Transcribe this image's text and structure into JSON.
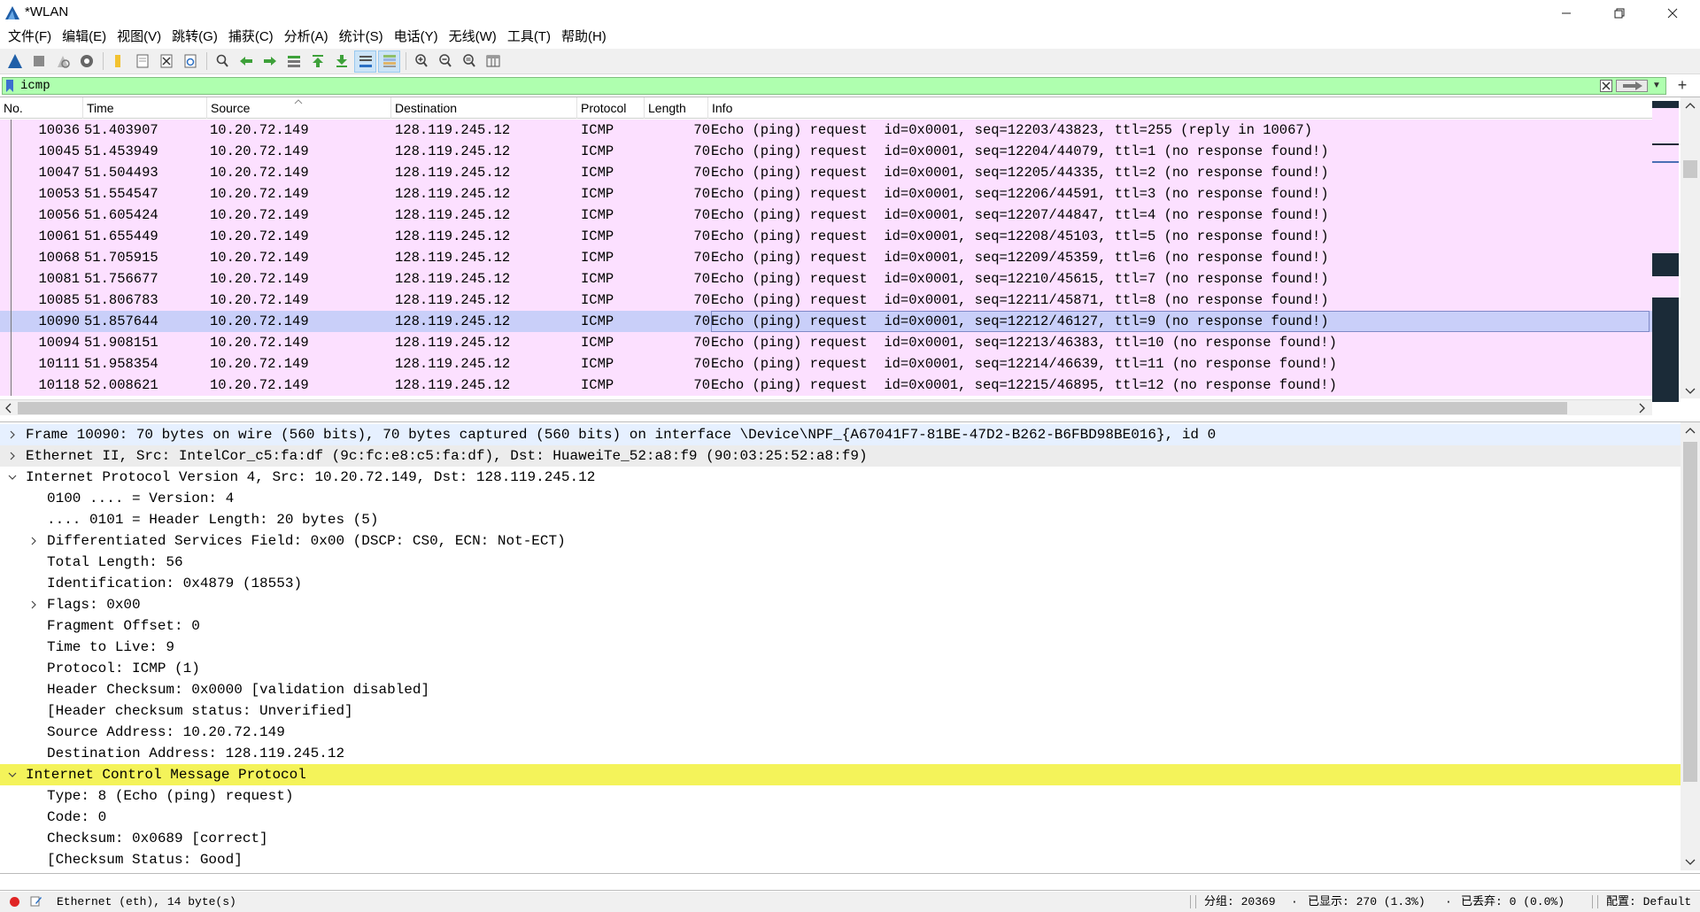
{
  "window": {
    "title": "*WLAN",
    "minimize_icon": "minimize-icon",
    "restore_icon": "restore-icon",
    "close_icon": "close-icon"
  },
  "menu": [
    {
      "label": "文件(F)"
    },
    {
      "label": "编辑(E)"
    },
    {
      "label": "视图(V)"
    },
    {
      "label": "跳转(G)"
    },
    {
      "label": "捕获(C)"
    },
    {
      "label": "分析(A)"
    },
    {
      "label": "统计(S)"
    },
    {
      "label": "电话(Y)"
    },
    {
      "label": "无线(W)"
    },
    {
      "label": "工具(T)"
    },
    {
      "label": "帮助(H)"
    }
  ],
  "toolbar": {
    "icons": [
      "shark-fin-start-icon",
      "stop-icon",
      "restart-icon",
      "capture-options-icon",
      "open-folder-icon",
      "save-file-icon",
      "close-file-icon",
      "reload-icon",
      "find-icon",
      "go-back-icon",
      "go-forward-icon",
      "go-to-packet-icon",
      "first-packet-icon",
      "last-packet-icon",
      "autoscroll-icon",
      "colorize-icon",
      "zoom-in-icon",
      "zoom-out-icon",
      "normal-size-icon",
      "resize-columns-icon"
    ]
  },
  "filter": {
    "value": "icmp",
    "bookmark_icon": "bookmark-icon",
    "clear_icon": "clear-filter-icon",
    "apply_icon": "apply-filter-arrow-icon",
    "dropdown_icon": "chevron-down-icon",
    "add_label": "+"
  },
  "packet_list": {
    "columns": {
      "no": "No.",
      "time": "Time",
      "source": "Source",
      "destination": "Destination",
      "protocol": "Protocol",
      "length": "Length",
      "info": "Info"
    },
    "rows": [
      {
        "no": "10036",
        "time": "51.403907",
        "src": "10.20.72.149",
        "dst": "128.119.245.12",
        "proto": "ICMP",
        "len": "70",
        "info": "Echo (ping) request  id=0x0001, seq=12203/43823, ttl=255 (reply in 10067)"
      },
      {
        "no": "10045",
        "time": "51.453949",
        "src": "10.20.72.149",
        "dst": "128.119.245.12",
        "proto": "ICMP",
        "len": "70",
        "info": "Echo (ping) request  id=0x0001, seq=12204/44079, ttl=1 (no response found!)"
      },
      {
        "no": "10047",
        "time": "51.504493",
        "src": "10.20.72.149",
        "dst": "128.119.245.12",
        "proto": "ICMP",
        "len": "70",
        "info": "Echo (ping) request  id=0x0001, seq=12205/44335, ttl=2 (no response found!)"
      },
      {
        "no": "10053",
        "time": "51.554547",
        "src": "10.20.72.149",
        "dst": "128.119.245.12",
        "proto": "ICMP",
        "len": "70",
        "info": "Echo (ping) request  id=0x0001, seq=12206/44591, ttl=3 (no response found!)"
      },
      {
        "no": "10056",
        "time": "51.605424",
        "src": "10.20.72.149",
        "dst": "128.119.245.12",
        "proto": "ICMP",
        "len": "70",
        "info": "Echo (ping) request  id=0x0001, seq=12207/44847, ttl=4 (no response found!)"
      },
      {
        "no": "10061",
        "time": "51.655449",
        "src": "10.20.72.149",
        "dst": "128.119.245.12",
        "proto": "ICMP",
        "len": "70",
        "info": "Echo (ping) request  id=0x0001, seq=12208/45103, ttl=5 (no response found!)"
      },
      {
        "no": "10068",
        "time": "51.705915",
        "src": "10.20.72.149",
        "dst": "128.119.245.12",
        "proto": "ICMP",
        "len": "70",
        "info": "Echo (ping) request  id=0x0001, seq=12209/45359, ttl=6 (no response found!)"
      },
      {
        "no": "10081",
        "time": "51.756677",
        "src": "10.20.72.149",
        "dst": "128.119.245.12",
        "proto": "ICMP",
        "len": "70",
        "info": "Echo (ping) request  id=0x0001, seq=12210/45615, ttl=7 (no response found!)"
      },
      {
        "no": "10085",
        "time": "51.806783",
        "src": "10.20.72.149",
        "dst": "128.119.245.12",
        "proto": "ICMP",
        "len": "70",
        "info": "Echo (ping) request  id=0x0001, seq=12211/45871, ttl=8 (no response found!)"
      },
      {
        "no": "10090",
        "time": "51.857644",
        "src": "10.20.72.149",
        "dst": "128.119.245.12",
        "proto": "ICMP",
        "len": "70",
        "info": "Echo (ping) request  id=0x0001, seq=12212/46127, ttl=9 (no response found!)",
        "selected": true
      },
      {
        "no": "10094",
        "time": "51.908151",
        "src": "10.20.72.149",
        "dst": "128.119.245.12",
        "proto": "ICMP",
        "len": "70",
        "info": "Echo (ping) request  id=0x0001, seq=12213/46383, ttl=10 (no response found!)"
      },
      {
        "no": "10111",
        "time": "51.958354",
        "src": "10.20.72.149",
        "dst": "128.119.245.12",
        "proto": "ICMP",
        "len": "70",
        "info": "Echo (ping) request  id=0x0001, seq=12214/46639, ttl=11 (no response found!)"
      },
      {
        "no": "10118",
        "time": "52.008621",
        "src": "10.20.72.149",
        "dst": "128.119.245.12",
        "proto": "ICMP",
        "len": "70",
        "info": "Echo (ping) request  id=0x0001, seq=12215/46895, ttl=12 (no response found!)"
      }
    ],
    "colors": {
      "row_bg": "#fce0ff",
      "selected_bg": "#c9cff9"
    }
  },
  "details": [
    {
      "text": "Frame 10090: 70 bytes on wire (560 bits), 70 bytes captured (560 bits) on interface \\Device\\NPF_{A67041F7-81BE-47D2-B262-B6FBD98BE016}, id 0",
      "level": 0,
      "toggle": "collapsed",
      "style": "frame"
    },
    {
      "text": "Ethernet II, Src: IntelCor_c5:fa:df (9c:fc:e8:c5:fa:df), Dst: HuaweiTe_52:a8:f9 (90:03:25:52:a8:f9)",
      "level": 0,
      "toggle": "collapsed",
      "style": "eth"
    },
    {
      "text": "Internet Protocol Version 4, Src: 10.20.72.149, Dst: 128.119.245.12",
      "level": 0,
      "toggle": "expanded",
      "style": ""
    },
    {
      "text": "0100 .... = Version: 4",
      "level": 1,
      "toggle": "",
      "style": ""
    },
    {
      "text": ".... 0101 = Header Length: 20 bytes (5)",
      "level": 1,
      "toggle": "",
      "style": ""
    },
    {
      "text": "Differentiated Services Field: 0x00 (DSCP: CS0, ECN: Not-ECT)",
      "level": 1,
      "toggle": "collapsed",
      "style": ""
    },
    {
      "text": "Total Length: 56",
      "level": 1,
      "toggle": "",
      "style": ""
    },
    {
      "text": "Identification: 0x4879 (18553)",
      "level": 1,
      "toggle": "",
      "style": ""
    },
    {
      "text": "Flags: 0x00",
      "level": 1,
      "toggle": "collapsed",
      "style": ""
    },
    {
      "text": "Fragment Offset: 0",
      "level": 1,
      "toggle": "",
      "style": ""
    },
    {
      "text": "Time to Live: 9",
      "level": 1,
      "toggle": "",
      "style": ""
    },
    {
      "text": "Protocol: ICMP (1)",
      "level": 1,
      "toggle": "",
      "style": ""
    },
    {
      "text": "Header Checksum: 0x0000 [validation disabled]",
      "level": 1,
      "toggle": "",
      "style": ""
    },
    {
      "text": "[Header checksum status: Unverified]",
      "level": 1,
      "toggle": "",
      "style": ""
    },
    {
      "text": "Source Address: 10.20.72.149",
      "level": 1,
      "toggle": "",
      "style": ""
    },
    {
      "text": "Destination Address: 128.119.245.12",
      "level": 1,
      "toggle": "",
      "style": ""
    },
    {
      "text": "Internet Control Message Protocol",
      "level": 0,
      "toggle": "expanded",
      "style": "icmp"
    },
    {
      "text": "Type: 8 (Echo (ping) request)",
      "level": 1,
      "toggle": "",
      "style": ""
    },
    {
      "text": "Code: 0",
      "level": 1,
      "toggle": "",
      "style": ""
    },
    {
      "text": "Checksum: 0x0689 [correct]",
      "level": 1,
      "toggle": "",
      "style": ""
    },
    {
      "text": "[Checksum Status: Good]",
      "level": 1,
      "toggle": "",
      "style": ""
    }
  ],
  "status": {
    "expert_icon": "expert-info-red-dot-icon",
    "edit_icon": "edit-comment-icon",
    "field_info": "Ethernet (eth), 14 byte(s)",
    "packets": "分组: 20369",
    "displayed": "已显示: 270 (1.3%)",
    "dropped": "已丢弃: 0 (0.0%)",
    "profile": "配置: Default"
  }
}
